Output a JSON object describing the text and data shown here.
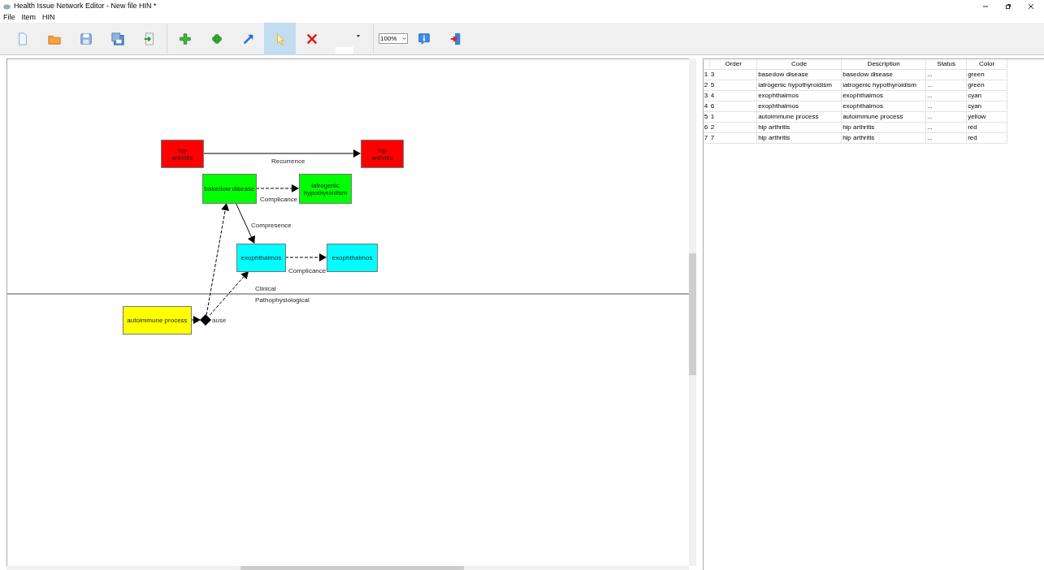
{
  "window": {
    "title": "Health Issue Network Editor - New file HIN *"
  },
  "menu": [
    "File",
    "Item",
    "HIN"
  ],
  "toolbar": {
    "buttons": [
      {
        "kind": "new",
        "selected": false
      },
      {
        "kind": "open",
        "selected": false
      },
      {
        "kind": "save",
        "selected": false
      },
      {
        "kind": "save-as",
        "selected": false
      },
      {
        "kind": "export",
        "selected": false
      },
      {
        "kind": "add",
        "selected": false
      },
      {
        "kind": "add-group",
        "selected": false
      },
      {
        "kind": "link",
        "selected": false
      },
      {
        "kind": "pointer",
        "selected": true
      },
      {
        "kind": "delete",
        "selected": false
      }
    ],
    "zoom": "100%",
    "end_buttons": [
      {
        "kind": "info"
      },
      {
        "kind": "exit"
      }
    ]
  },
  "diagram": {
    "lanes": [
      "Clinical",
      "Pathophysiological"
    ],
    "nodes": [
      {
        "label": "hip arthritis",
        "color": "#ff0000"
      },
      {
        "label": "hip arthritis",
        "color": "#ff0000"
      },
      {
        "label": "basedow disease",
        "color": "#00ff00"
      },
      {
        "label": "iatrogenic hypothyroidism",
        "color": "#00ff00"
      },
      {
        "label": "exophthalmos",
        "color": "#00ffff"
      },
      {
        "label": "exophthalmos",
        "color": "#00ffff"
      },
      {
        "label": "autoimmune process",
        "color": "#ffff00"
      }
    ],
    "junction": {
      "label": "ause"
    },
    "edge_labels": [
      "Recurrence",
      "Complicance",
      "Compresence",
      "Complicance"
    ]
  },
  "table": {
    "columns": [
      "Order",
      "Code",
      "Description",
      "Status",
      "Color"
    ],
    "rows": [
      {
        "header": "1",
        "cells": [
          "3",
          "basedow disease",
          "basedow disease",
          "...",
          "green"
        ]
      },
      {
        "header": "2",
        "cells": [
          "5",
          "iatrogenic hypothyroidism",
          "iatrogenic hypothyroidism",
          "...",
          "green"
        ]
      },
      {
        "header": "3",
        "cells": [
          "4",
          "exophthalmos",
          "exophthalmos",
          "...",
          "cyan"
        ]
      },
      {
        "header": "4",
        "cells": [
          "6",
          "exophthalmos",
          "exophthalmos",
          "...",
          "cyan"
        ]
      },
      {
        "header": "5",
        "cells": [
          "1",
          "autoimmune process",
          "autoimmune process",
          "...",
          "yellow"
        ]
      },
      {
        "header": "6",
        "cells": [
          "2",
          "hip arthritis",
          "hip arthritis",
          "...",
          "red"
        ]
      },
      {
        "header": "7",
        "cells": [
          "7",
          "hip arthritis",
          "hip arthritis",
          "...",
          "red"
        ]
      }
    ]
  }
}
